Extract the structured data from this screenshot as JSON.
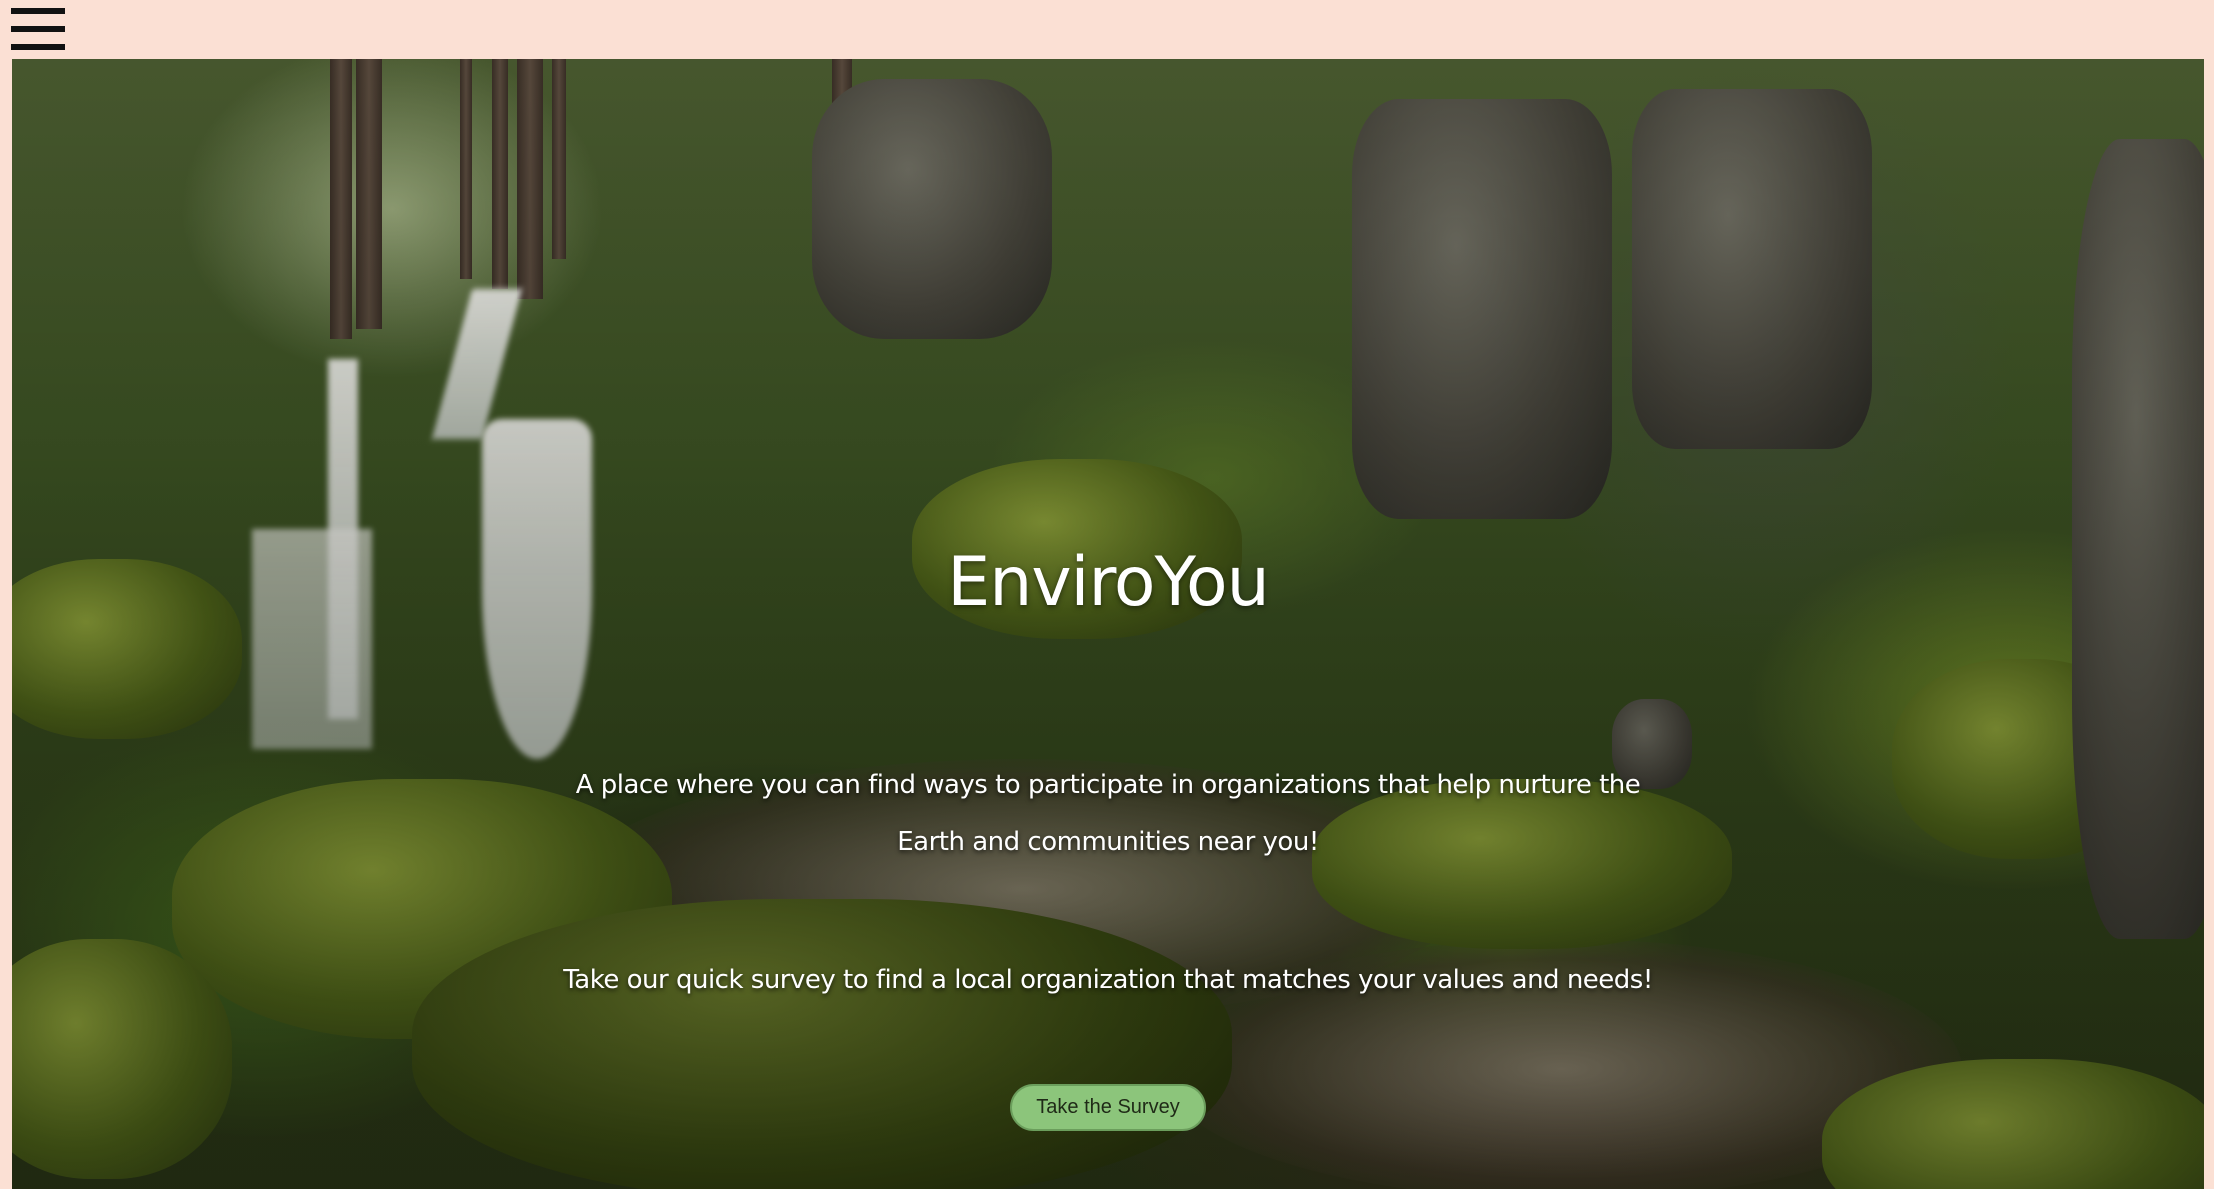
{
  "nav": {
    "menu_icon": "hamburger-menu-icon"
  },
  "hero": {
    "background": "mossy-forest-waterfall-photo",
    "title": "EnviroYou",
    "subtitle": "A place where you can find ways to participate in organizations that help nurture the  Earth and communities near you!",
    "cta_text": "Take our quick survey to find a local organization that matches your values and needs!",
    "survey_button_label": "Take the Survey"
  },
  "colors": {
    "header_bg": "#fbe0d4",
    "button_bg": "#8cc57b",
    "text": "#ffffff"
  }
}
